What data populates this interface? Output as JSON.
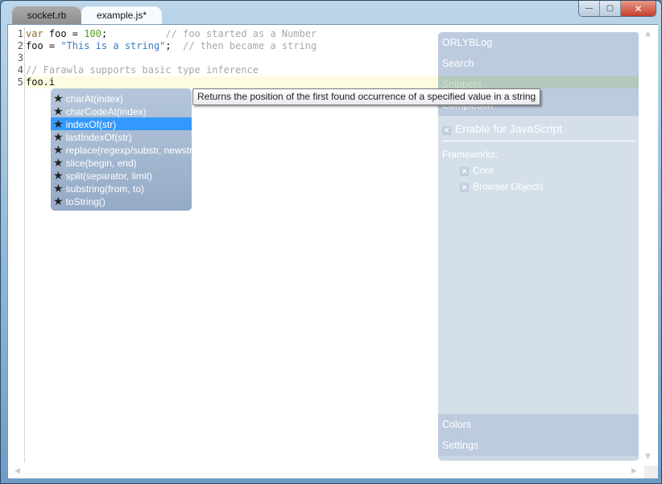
{
  "window": {
    "tabs": [
      {
        "label": "socket.rb",
        "active": false
      },
      {
        "label": "example.js*",
        "active": true
      }
    ],
    "controls": {
      "minimize": "—",
      "maximize": "▢",
      "close": "✕"
    }
  },
  "editor": {
    "line_numbers": [
      "1",
      "2",
      "3",
      "4",
      "5"
    ],
    "lines": [
      [
        {
          "t": "var",
          "c": "kw"
        },
        {
          "t": " foo = ",
          "c": "pl"
        },
        {
          "t": "100",
          "c": "num"
        },
        {
          "t": ";          ",
          "c": "pl"
        },
        {
          "t": "// foo started as a Number",
          "c": "cm"
        }
      ],
      [
        {
          "t": "foo = ",
          "c": "pl"
        },
        {
          "t": "\"This is a string\"",
          "c": "str"
        },
        {
          "t": ";  ",
          "c": "pl"
        },
        {
          "t": "// then became a string",
          "c": "cm"
        }
      ],
      [],
      [
        {
          "t": "// Farawla supports basic type inference",
          "c": "cm"
        }
      ],
      [
        {
          "t": "foo.i",
          "c": "pl"
        }
      ]
    ]
  },
  "autocomplete": {
    "icon": "star-icon",
    "selected_index": 2,
    "items": [
      "charAt(index)",
      "charCodeAt(index)",
      "indexOf(str)",
      "lastIndexOf(str)",
      "replace(regexp/substr, newstr)",
      "slice(begin, end)",
      "split(separator, limit)",
      "substring(from, to)",
      "toString()"
    ]
  },
  "tooltip": {
    "text": "Returns the position of the first found occurrence of a specified value in a string"
  },
  "panel": {
    "sections_top": [
      "ORLYBLog",
      "Search",
      "Snippets",
      "Completion"
    ],
    "enable_label": "Enable for JavaScript",
    "frameworks_label": "Frameworks:",
    "frameworks": [
      "Core",
      "Browser Objects"
    ],
    "sections_bottom": [
      "Colors",
      "Settings"
    ],
    "checkmark": "✕"
  }
}
